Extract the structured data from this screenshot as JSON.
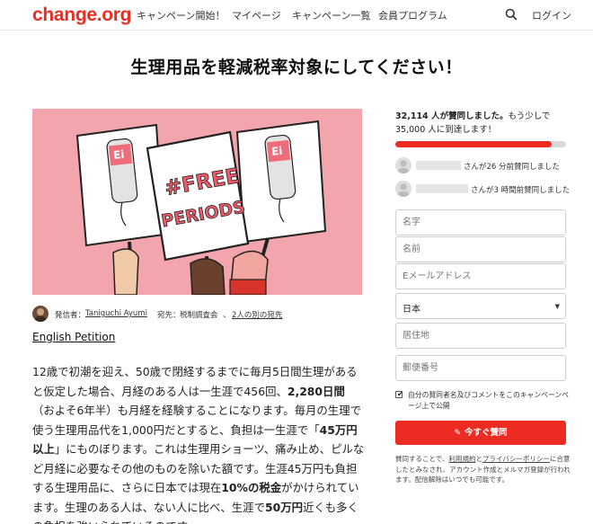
{
  "header": {
    "logo": "change.org",
    "nav": [
      "キャンペーン開始！",
      "マイページ",
      "キャンペーン一覧",
      "会員プログラム"
    ],
    "search_icon": "search-icon",
    "login": "ログイン",
    "brand_color": "#ec2c22"
  },
  "title": "生理用品を軽減税率対象にしてください！",
  "hero": {
    "sign_text_line1": "#FREE",
    "sign_text_line2": "PERIODS",
    "side_sign_text": "Ei"
  },
  "author": {
    "prefix": "発信者：",
    "name": "Taniguchi Ayumi",
    "to_prefix": "宛先：",
    "to": "税制調査会",
    "sep": "、",
    "others": "2人の別の宛先"
  },
  "english_link": "English Petition",
  "body": {
    "p1": "12歳で初潮を迎え、50歳で閉経するまでに毎月5日間生理があると仮定した場合、月経のある人は一生涯で456回、",
    "b1": "2,280日間",
    "p2": "（およそ6年半）も月経を経験することになります。毎月の生理で使う生理用品代を1,000円だとすると、負担は一生涯で「",
    "b2": "45万円以上",
    "p3": "」にものぼります。これは生理用ショーツ、痛み止め、ピルなど月経に必要なその他のものを除いた額です。生涯45万円も負担する生理用品に、さらに日本では現在",
    "b3": "10%の税金",
    "p4": "がかけられています。生理のある人は、ない人に比べ、生涯で",
    "b4": "50万円",
    "p5": "近くも多くの負担を強いられているのです。"
  },
  "sidebar": {
    "count": "32,114",
    "count_suffix": " 人が賛同しました。",
    "count_more": "もう少しで",
    "goal": "35,000",
    "goal_suffix": " 人に到達します！",
    "progress": 0.9175,
    "signers": [
      {
        "text": "さんが26 分前賛同しました"
      },
      {
        "text": "さんが3 時間前賛同しました"
      }
    ],
    "form": {
      "first_name": "名字",
      "last_name": "名前",
      "email": "Eメールアドレス",
      "country": "日本",
      "city": "居住地",
      "zip": "郵便番号"
    },
    "checkbox_label": "自分の賛同者名及びコメントをこのキャンペーンページ上で公開",
    "sign_button": "今すぐ賛同",
    "terms": {
      "pre": "賛同することで、",
      "link1": "利用規約",
      "mid": "と",
      "link2": "プライバシーポリシー",
      "post": "に合意したとみなされ、アカウント作成とメルマガ登録が行われます。配信解除はいつでも可能です。"
    }
  }
}
